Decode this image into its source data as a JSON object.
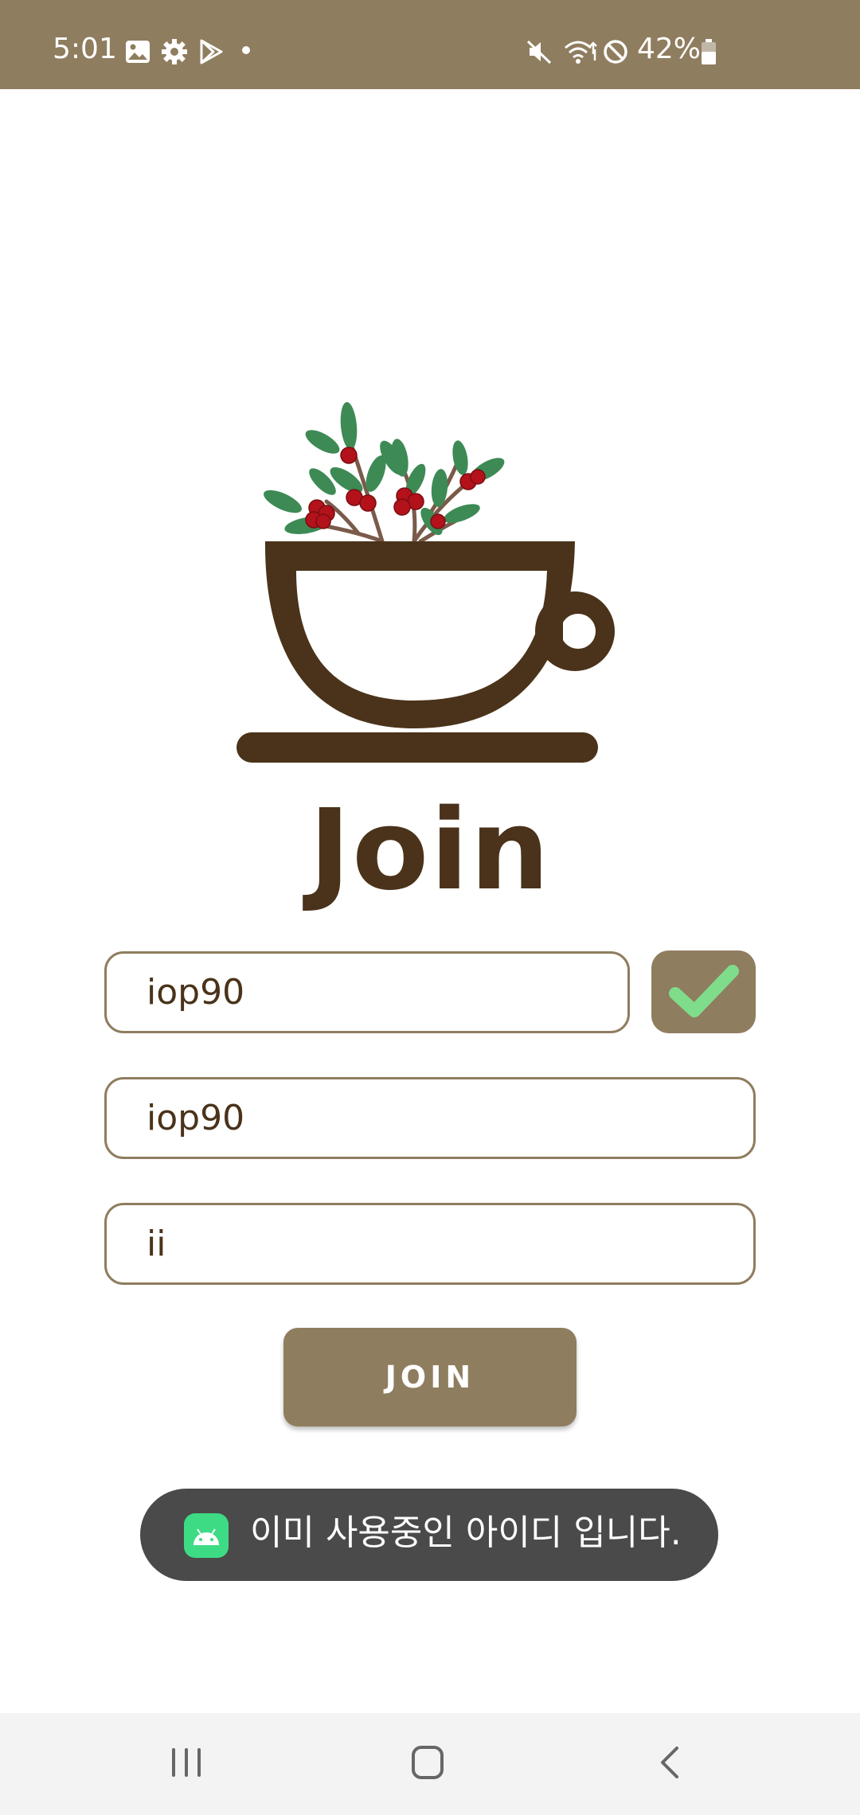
{
  "status_bar": {
    "time": "5:01",
    "battery_percent": "42%",
    "background_color": "#8f7d5f",
    "icons_left": [
      "image-icon",
      "settings-gear-icon",
      "play-store-icon",
      "notification-dot-icon"
    ],
    "icons_right": [
      "mute-icon",
      "wifi-icon",
      "do-not-disturb-icon",
      "battery-icon"
    ]
  },
  "page": {
    "title": "Join",
    "logo": "coffee-cup-with-coffee-berries"
  },
  "form": {
    "id_value": "iop90",
    "password_value": "iop90",
    "name_value": "ii",
    "check_button_icon": "checkmark-icon",
    "join_button_label": "JOIN",
    "accent_color": "#8f7d5f",
    "text_color": "#4a331a"
  },
  "toast": {
    "message": "이미 사용중인 아이디 입니다.",
    "icon": "android-app-icon"
  },
  "nav_bar": {
    "buttons": [
      "recent-apps-button",
      "home-button",
      "back-button"
    ]
  }
}
